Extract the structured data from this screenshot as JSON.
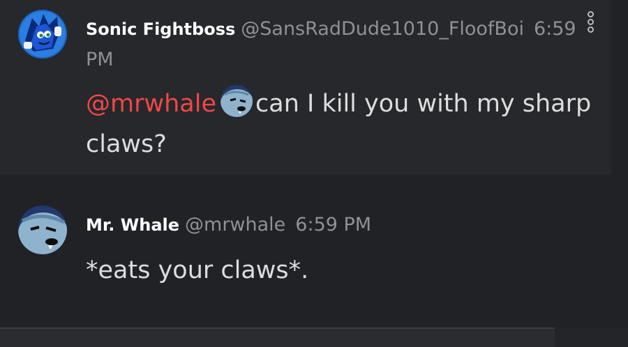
{
  "messages": [
    {
      "username": "Sonic Fightboss",
      "handle": "@SansRadDude1010_FloofBoi",
      "time": "6:59 PM",
      "mention": "@mrwhale",
      "text": "can I kill you with my sharp claws?",
      "avatar_icon": "sonic-avatar-icon",
      "emoji_icon": "whale-emoji-icon"
    },
    {
      "username": "Mr. Whale",
      "handle": "@mrwhale",
      "time": "6:59 PM",
      "text": "*eats your claws*.",
      "avatar_icon": "whale-avatar-icon"
    }
  ],
  "colors": {
    "background": "#202225",
    "highlight": "#26282b",
    "mention": "#f04747",
    "username": "#ffffff",
    "meta": "#8e9297",
    "text": "#dcddde"
  }
}
